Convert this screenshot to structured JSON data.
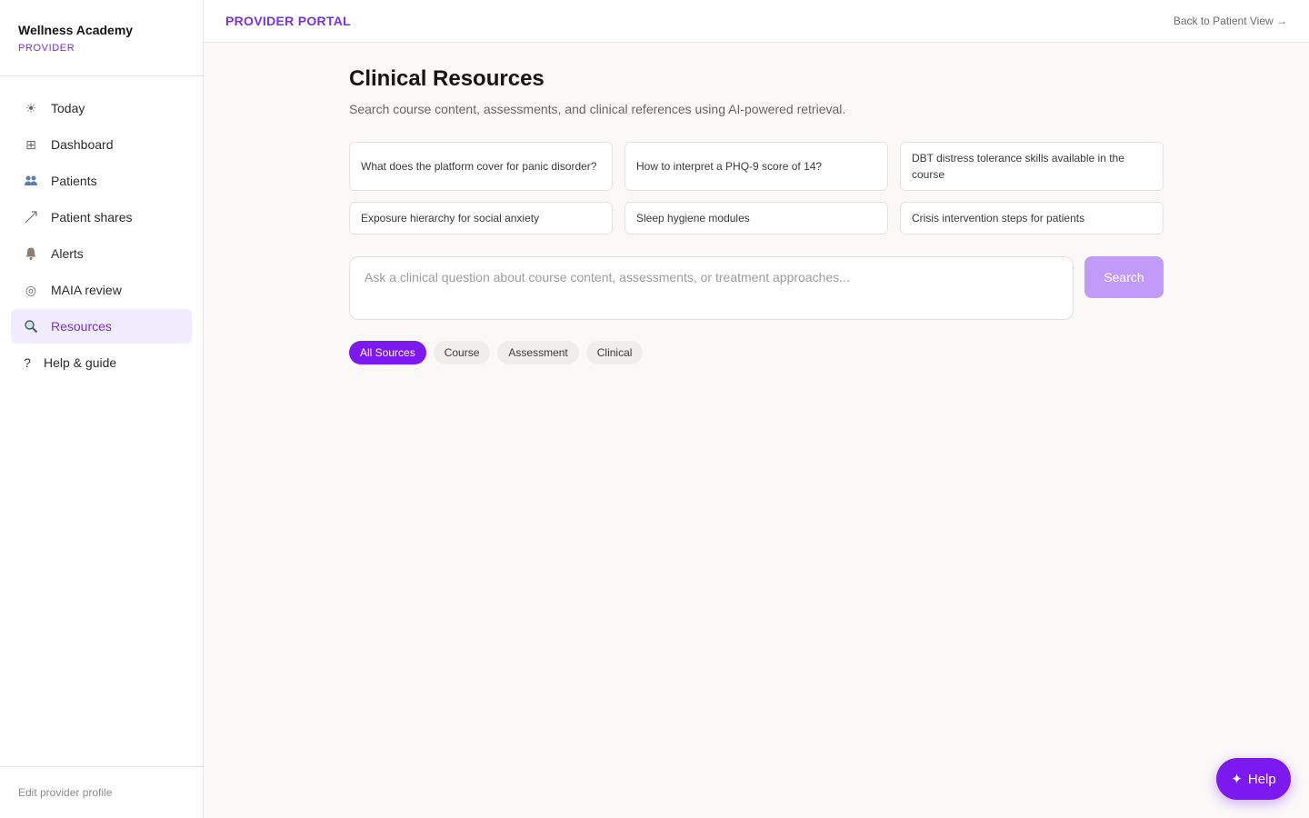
{
  "brand": {
    "name": "Wellness Academy",
    "role": "PROVIDER"
  },
  "sidebar": {
    "items": [
      {
        "label": "Today",
        "icon": "sun-icon"
      },
      {
        "label": "Dashboard",
        "icon": "grid-icon"
      },
      {
        "label": "Patients",
        "icon": "people-icon"
      },
      {
        "label": "Patient shares",
        "icon": "arrow-icon"
      },
      {
        "label": "Alerts",
        "icon": "bell-icon"
      },
      {
        "label": "MAIA review",
        "icon": "circle-icon"
      },
      {
        "label": "Resources",
        "icon": "magnifier-icon",
        "active": true
      },
      {
        "label": "Help & guide",
        "icon": "question-icon"
      }
    ],
    "footer_link": "Edit provider profile"
  },
  "header": {
    "portal_label": "PROVIDER PORTAL",
    "back_link": "Back to Patient View →"
  },
  "main": {
    "title": "Clinical Resources",
    "subtitle": "Search course content, assessments, and clinical references using AI-powered retrieval.",
    "suggestions": [
      "What does the platform cover for panic disorder?",
      "How to interpret a PHQ-9 score of 14?",
      "DBT distress tolerance skills available in the course",
      "Exposure hierarchy for social anxiety",
      "Sleep hygiene modules",
      "Crisis intervention steps for patients"
    ],
    "search": {
      "placeholder": "Ask a clinical question about course content, assessments, or treatment approaches...",
      "button_label": "Search"
    },
    "filters": [
      {
        "label": "All Sources",
        "active": true
      },
      {
        "label": "Course"
      },
      {
        "label": "Assessment"
      },
      {
        "label": "Clinical"
      }
    ]
  },
  "help_fab": {
    "icon": "sparkle-icon",
    "label": "Help"
  },
  "colors": {
    "accent": "#7c2ee8",
    "button_disabled": "#c29af7",
    "chip_active": "#7c19f0"
  }
}
